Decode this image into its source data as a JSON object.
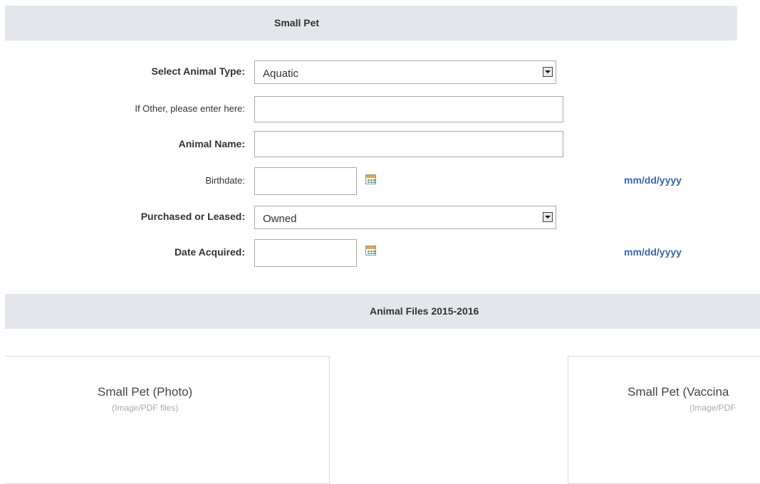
{
  "sections": {
    "small_pet": "Small Pet",
    "animal_files": "Animal Files 2015-2016"
  },
  "form": {
    "animal_type_label": "Select Animal Type:",
    "animal_type_value": "Aquatic",
    "other_label": "If Other, please enter here:",
    "other_value": "",
    "name_label": "Animal Name:",
    "name_value": "",
    "birthdate_label": "Birthdate:",
    "birthdate_value": "",
    "birthdate_format": "mm/dd/yyyy",
    "purchased_label": "Purchased or Leased:",
    "purchased_value": "Owned",
    "acquired_label": "Date Acquired:",
    "acquired_value": "",
    "acquired_format": "mm/dd/yyyy"
  },
  "files": [
    {
      "title": "Small Pet (Photo)",
      "subtitle": "(Image/PDF files)"
    },
    {
      "title": "Small Pet (Vaccina",
      "subtitle": "(Image/PDF"
    }
  ],
  "icons": {
    "calendar": "calendar-icon",
    "dropdown": "chevron-down-icon"
  }
}
